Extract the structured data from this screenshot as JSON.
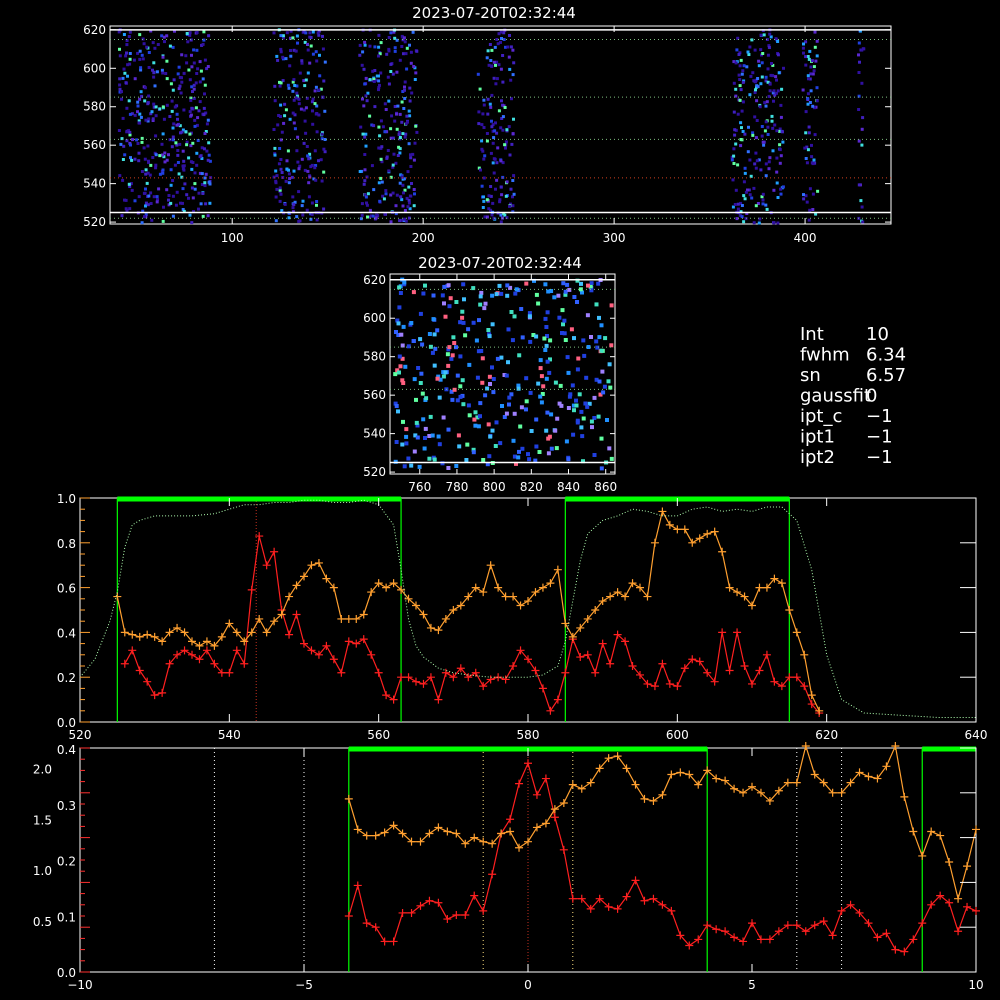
{
  "panels": {
    "top_title": "2023-07-20T02:32:44",
    "mid_title": "2023-07-20T02:32:44"
  },
  "info": {
    "lines": [
      {
        "label": "Int",
        "value": "10"
      },
      {
        "label": "fwhm",
        "value": "6.34"
      },
      {
        "label": "sn",
        "value": "6.57"
      },
      {
        "label": "gaussfit",
        "value": "0"
      },
      {
        "label": "ipt_c",
        "value": "−1"
      },
      {
        "label": "ipt1",
        "value": "−1"
      },
      {
        "label": "ipt2",
        "value": "−1"
      }
    ]
  },
  "colors": {
    "red": "#ff2020",
    "orange": "#ffa030",
    "green": "#00ff00",
    "dotted_green": "#b0ffb0"
  },
  "chart_data": [
    {
      "type": "heatmap",
      "title": "2023-07-20T02:32:44",
      "xlim": [
        36,
        445
      ],
      "ylim": [
        519,
        622
      ],
      "xticks": [
        100,
        200,
        300,
        400
      ],
      "yticks": [
        520,
        540,
        560,
        580,
        600,
        620
      ],
      "hlines": [
        {
          "y": 620,
          "color": "#ffffff",
          "style": "solid"
        },
        {
          "y": 615,
          "color": "#7fbf7f",
          "style": "dotted"
        },
        {
          "y": 585,
          "color": "#7fbf7f",
          "style": "dotted"
        },
        {
          "y": 563,
          "color": "#7fbf7f",
          "style": "dotted"
        },
        {
          "y": 543,
          "color": "#d04020",
          "style": "dotted"
        },
        {
          "y": 525,
          "color": "#ffffff",
          "style": "solid"
        },
        {
          "y": 522,
          "color": "#7fbf7f",
          "style": "dotted"
        }
      ],
      "bands": [
        [
          40,
          88
        ],
        [
          121,
          148
        ],
        [
          166,
          196
        ],
        [
          228,
          247
        ],
        [
          361,
          388
        ],
        [
          398,
          406
        ],
        [
          427,
          430
        ]
      ]
    },
    {
      "type": "heatmap",
      "title": "2023-07-20T02:32:44",
      "xlim": [
        744,
        865
      ],
      "ylim": [
        519,
        623
      ],
      "xticks": [
        760,
        780,
        800,
        820,
        840,
        860
      ],
      "yticks": [
        520,
        540,
        560,
        580,
        600,
        620
      ],
      "hlines": [
        {
          "y": 620,
          "color": "#ffffff",
          "style": "solid"
        },
        {
          "y": 615,
          "color": "#7fbf7f",
          "style": "dotted"
        },
        {
          "y": 585,
          "color": "#7fbf7f",
          "style": "dotted"
        },
        {
          "y": 563,
          "color": "#7fbf7f",
          "style": "dotted"
        },
        {
          "y": 525,
          "color": "#ffffff",
          "style": "solid"
        }
      ]
    },
    {
      "type": "line",
      "xlim": [
        520,
        640
      ],
      "xticks": [
        520,
        540,
        560,
        580,
        600,
        620,
        640
      ],
      "yticks_left": [
        "0.0",
        "0.2",
        "0.4",
        "0.6",
        "0.8",
        "1.0"
      ],
      "ylim": [
        0,
        1
      ],
      "green_bars": [
        [
          525,
          563
        ],
        [
          585,
          615
        ]
      ],
      "red_vline": 543.6,
      "series": [
        {
          "color": "red",
          "x": [
            526,
            527,
            528,
            529,
            530,
            531,
            532,
            533,
            534,
            535,
            536,
            537,
            538,
            539,
            540,
            541,
            542,
            543,
            544,
            545,
            546,
            547,
            548,
            549,
            550,
            551,
            552,
            553,
            554,
            555,
            556,
            557,
            558,
            559,
            560,
            561,
            562,
            563,
            564,
            565,
            566,
            567,
            568,
            569,
            570,
            571,
            572,
            573,
            574,
            575,
            576,
            577,
            578,
            579,
            580,
            581,
            582,
            583,
            584,
            585,
            586,
            587,
            588,
            589,
            590,
            591,
            592,
            593,
            594,
            595,
            596,
            597,
            598,
            599,
            600,
            601,
            602,
            603,
            604,
            605,
            606,
            607,
            608,
            609,
            610,
            611,
            612,
            613,
            614,
            615,
            616,
            617,
            618,
            619
          ],
          "y": [
            0.26,
            0.32,
            0.23,
            0.18,
            0.12,
            0.13,
            0.26,
            0.3,
            0.32,
            0.3,
            0.28,
            0.32,
            0.26,
            0.22,
            0.22,
            0.32,
            0.26,
            0.59,
            0.83,
            0.7,
            0.76,
            0.5,
            0.39,
            0.48,
            0.35,
            0.32,
            0.3,
            0.34,
            0.28,
            0.22,
            0.36,
            0.35,
            0.37,
            0.3,
            0.22,
            0.12,
            0.1,
            0.2,
            0.2,
            0.18,
            0.17,
            0.2,
            0.1,
            0.22,
            0.2,
            0.24,
            0.2,
            0.22,
            0.16,
            0.19,
            0.2,
            0.19,
            0.25,
            0.32,
            0.28,
            0.23,
            0.15,
            0.05,
            0.1,
            0.22,
            0.37,
            0.29,
            0.3,
            0.22,
            0.35,
            0.26,
            0.39,
            0.36,
            0.25,
            0.21,
            0.17,
            0.16,
            0.26,
            0.17,
            0.16,
            0.24,
            0.28,
            0.27,
            0.22,
            0.18,
            0.4,
            0.23,
            0.4,
            0.25,
            0.17,
            0.23,
            0.3,
            0.18,
            0.16,
            0.2,
            0.2,
            0.16,
            0.08,
            0.04
          ]
        },
        {
          "color": "orange",
          "x": [
            525,
            526,
            527,
            528,
            529,
            530,
            531,
            532,
            533,
            534,
            535,
            536,
            537,
            538,
            539,
            540,
            541,
            542,
            543,
            544,
            545,
            546,
            547,
            548,
            549,
            550,
            551,
            552,
            553,
            554,
            555,
            556,
            557,
            558,
            559,
            560,
            561,
            562,
            563,
            564,
            565,
            566,
            567,
            568,
            569,
            570,
            571,
            572,
            573,
            574,
            575,
            576,
            577,
            578,
            579,
            580,
            581,
            582,
            583,
            584,
            585,
            586,
            587,
            588,
            589,
            590,
            591,
            592,
            593,
            594,
            595,
            596,
            597,
            598,
            599,
            600,
            601,
            602,
            603,
            604,
            605,
            606,
            607,
            608,
            609,
            610,
            611,
            612,
            613,
            614,
            615,
            616,
            617,
            618,
            619
          ],
          "y": [
            0.56,
            0.4,
            0.39,
            0.38,
            0.39,
            0.38,
            0.36,
            0.4,
            0.42,
            0.4,
            0.36,
            0.34,
            0.36,
            0.34,
            0.38,
            0.44,
            0.4,
            0.36,
            0.4,
            0.46,
            0.4,
            0.45,
            0.48,
            0.56,
            0.61,
            0.65,
            0.7,
            0.71,
            0.64,
            0.6,
            0.46,
            0.46,
            0.46,
            0.48,
            0.58,
            0.62,
            0.6,
            0.62,
            0.59,
            0.55,
            0.52,
            0.48,
            0.42,
            0.41,
            0.46,
            0.5,
            0.52,
            0.56,
            0.6,
            0.58,
            0.7,
            0.6,
            0.56,
            0.56,
            0.52,
            0.54,
            0.58,
            0.6,
            0.62,
            0.68,
            0.44,
            0.38,
            0.42,
            0.46,
            0.5,
            0.54,
            0.56,
            0.58,
            0.56,
            0.62,
            0.6,
            0.56,
            0.8,
            0.94,
            0.88,
            0.86,
            0.86,
            0.8,
            0.82,
            0.84,
            0.85,
            0.76,
            0.6,
            0.58,
            0.56,
            0.52,
            0.6,
            0.6,
            0.64,
            0.62,
            0.5,
            0.4,
            0.3,
            0.12,
            0.05
          ]
        },
        {
          "color": "dotted_green",
          "x": [
            520,
            522,
            524,
            525,
            526,
            527,
            528,
            530,
            532,
            535,
            538,
            540,
            542,
            544,
            546,
            548,
            550,
            552,
            554,
            556,
            558,
            560,
            562,
            563,
            564,
            565,
            566,
            568,
            570,
            572,
            575,
            578,
            580,
            582,
            584,
            585,
            586,
            587,
            588,
            590,
            592,
            594,
            596,
            598,
            600,
            602,
            604,
            606,
            608,
            610,
            612,
            614,
            616,
            618,
            620,
            622,
            625,
            630,
            635,
            640
          ],
          "y": [
            0.2,
            0.28,
            0.45,
            0.58,
            0.78,
            0.88,
            0.9,
            0.92,
            0.92,
            0.92,
            0.93,
            0.95,
            0.97,
            0.97,
            0.98,
            0.98,
            0.99,
            0.99,
            0.98,
            0.98,
            0.99,
            0.97,
            0.88,
            0.68,
            0.46,
            0.34,
            0.29,
            0.24,
            0.22,
            0.21,
            0.2,
            0.2,
            0.2,
            0.21,
            0.25,
            0.36,
            0.54,
            0.72,
            0.84,
            0.9,
            0.92,
            0.95,
            0.94,
            0.92,
            0.92,
            0.95,
            0.96,
            0.94,
            0.95,
            0.94,
            0.96,
            0.96,
            0.9,
            0.68,
            0.3,
            0.1,
            0.04,
            0.03,
            0.02,
            0.02
          ]
        }
      ]
    },
    {
      "type": "line",
      "xlim": [
        -10,
        10
      ],
      "xticks": [
        -10,
        -5,
        0,
        5,
        10
      ],
      "yticks_left_orange": [
        "0.0",
        "0.1",
        "0.2",
        "0.3",
        "0.4"
      ],
      "yticks_left_red": [
        "0.5",
        "1.0",
        "1.5",
        "2.0"
      ],
      "ylim": [
        0,
        2.2
      ],
      "green_bars": [
        [
          -4.0,
          4.0
        ],
        [
          8.8,
          10.0
        ]
      ],
      "white_dotted_vlines": [
        -7.0,
        -5.0,
        6.0,
        7.0
      ],
      "yellow_dotted_vlines": [
        -1.0,
        1.0
      ],
      "red_dotted_vline": 0.0,
      "series": [
        {
          "color": "red",
          "x": [
            -4.0,
            -3.8,
            -3.6,
            -3.4,
            -3.2,
            -3.0,
            -2.8,
            -2.6,
            -2.4,
            -2.2,
            -2.0,
            -1.8,
            -1.6,
            -1.4,
            -1.2,
            -1.0,
            -0.8,
            -0.6,
            -0.4,
            -0.2,
            0.0,
            0.2,
            0.4,
            0.6,
            0.8,
            1.0,
            1.2,
            1.4,
            1.6,
            1.8,
            2.0,
            2.2,
            2.4,
            2.6,
            2.8,
            3.0,
            3.2,
            3.4,
            3.6,
            3.8,
            4.0,
            4.2,
            4.4,
            4.6,
            4.8,
            5.0,
            5.2,
            5.4,
            5.6,
            5.8,
            6.0,
            6.2,
            6.4,
            6.6,
            6.8,
            7.0,
            7.2,
            7.4,
            7.6,
            7.8,
            8.0,
            8.2,
            8.4,
            8.6,
            8.8,
            9.0,
            9.2,
            9.4,
            9.6,
            9.8,
            10.0
          ],
          "y": [
            0.55,
            0.85,
            0.48,
            0.44,
            0.3,
            0.3,
            0.58,
            0.58,
            0.65,
            0.7,
            0.68,
            0.52,
            0.56,
            0.56,
            0.75,
            0.6,
            0.96,
            1.36,
            1.5,
            1.85,
            2.05,
            1.74,
            1.9,
            1.52,
            1.2,
            0.72,
            0.72,
            0.62,
            0.72,
            0.64,
            0.62,
            0.74,
            0.9,
            0.7,
            0.72,
            0.66,
            0.6,
            0.36,
            0.26,
            0.32,
            0.46,
            0.42,
            0.4,
            0.34,
            0.3,
            0.48,
            0.32,
            0.32,
            0.4,
            0.46,
            0.46,
            0.4,
            0.46,
            0.5,
            0.36,
            0.6,
            0.66,
            0.58,
            0.48,
            0.34,
            0.38,
            0.22,
            0.2,
            0.32,
            0.48,
            0.66,
            0.75,
            0.68,
            0.4,
            0.64,
            0.6
          ]
        },
        {
          "color": "orange",
          "x": [
            -4.0,
            -3.8,
            -3.6,
            -3.4,
            -3.2,
            -3.0,
            -2.8,
            -2.6,
            -2.4,
            -2.2,
            -2.0,
            -1.8,
            -1.6,
            -1.4,
            -1.2,
            -1.0,
            -0.8,
            -0.6,
            -0.4,
            -0.2,
            0.0,
            0.2,
            0.4,
            0.6,
            0.8,
            1.0,
            1.2,
            1.4,
            1.6,
            1.8,
            2.0,
            2.2,
            2.4,
            2.6,
            2.8,
            3.0,
            3.2,
            3.4,
            3.6,
            3.8,
            4.0,
            4.2,
            4.4,
            4.6,
            4.8,
            5.0,
            5.2,
            5.4,
            5.6,
            5.8,
            6.0,
            6.2,
            6.4,
            6.6,
            6.8,
            7.0,
            7.2,
            7.4,
            7.6,
            7.8,
            8.0,
            8.2,
            8.4,
            8.6,
            8.8,
            9.0,
            9.2,
            9.4,
            9.6,
            9.8,
            10.0
          ],
          "y": [
            1.7,
            1.4,
            1.34,
            1.34,
            1.37,
            1.44,
            1.36,
            1.28,
            1.28,
            1.36,
            1.42,
            1.38,
            1.36,
            1.26,
            1.32,
            1.28,
            1.26,
            1.36,
            1.38,
            1.22,
            1.28,
            1.42,
            1.46,
            1.6,
            1.66,
            1.84,
            1.8,
            1.86,
            2.0,
            2.1,
            2.12,
            2.0,
            1.84,
            1.7,
            1.68,
            1.74,
            1.94,
            1.96,
            1.94,
            1.84,
            1.98,
            1.9,
            1.88,
            1.8,
            1.76,
            1.82,
            1.76,
            1.68,
            1.78,
            1.86,
            1.86,
            2.22,
            1.94,
            1.86,
            1.76,
            1.76,
            1.86,
            1.96,
            1.92,
            1.9,
            2.02,
            2.22,
            1.72,
            1.38,
            1.14,
            1.38,
            1.34,
            1.08,
            0.72,
            1.04,
            1.4
          ]
        }
      ]
    }
  ]
}
